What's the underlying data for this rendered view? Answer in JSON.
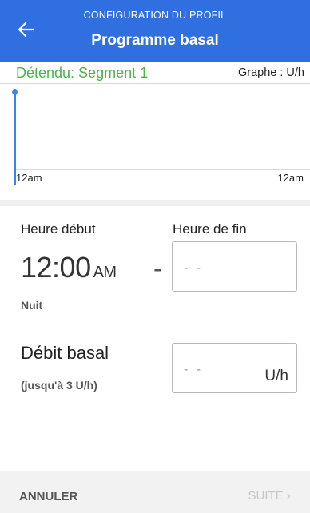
{
  "header": {
    "subtitle": "CONFIGURATION DU PROFIL",
    "title": "Programme basal",
    "back_icon": "arrow-left-icon"
  },
  "segment": {
    "label": "Détendu: Segment 1",
    "graph_unit": "Graphe : U/h",
    "color": "#4db34a"
  },
  "graph": {
    "tick_start": "12am",
    "tick_end": "12am",
    "line_color": "#3b82f6"
  },
  "form": {
    "start_label": "Heure début",
    "end_label": "Heure de fin",
    "start_time": "12:00",
    "start_ampm": "AM",
    "separator": "-",
    "end_placeholder": "- -",
    "period": "Nuit",
    "rate_label": "Débit basal",
    "rate_hint": "(jusqu'à 3 U/h)",
    "rate_placeholder": "- -",
    "rate_unit": "U/h"
  },
  "footer": {
    "cancel": "ANNULER",
    "next": "SUITE",
    "next_icon": "chevron-right-icon"
  }
}
